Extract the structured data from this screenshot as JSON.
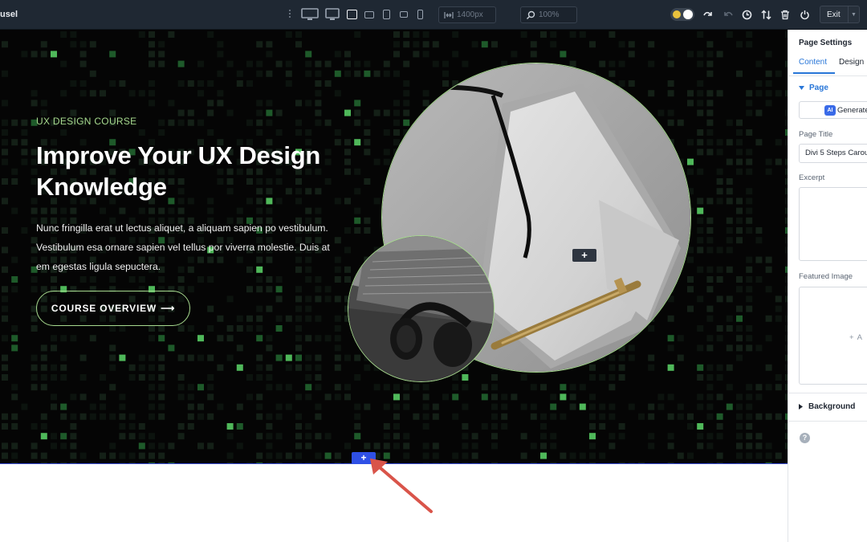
{
  "toolbar": {
    "title": "usel",
    "width_value": "1400px",
    "zoom_value": "100%",
    "exit_label": "Exit",
    "icons": [
      "desktop-wide-icon",
      "desktop-icon",
      "laptop-icon",
      "tablet-landscape-icon",
      "tablet-portrait-icon",
      "phone-landscape-icon",
      "phone-portrait-icon",
      "width-icon",
      "zoom-icon",
      "theme-toggle",
      "undo-icon",
      "redo-icon",
      "history-icon",
      "sort-icon",
      "trash-icon",
      "power-icon"
    ]
  },
  "hero": {
    "kicker": "UX DESIGN COURSE",
    "headline": "Improve Your UX Design Knowledge",
    "body": "Nunc fringilla erat ut lectus aliquet, a aliquam sapien po vestibulum. Vestibulum esa ornare sapien vel tellus por viverra molestie. Duis at em egestas ligula sepuctera.",
    "cta_label": "COURSE OVERVIEW",
    "cta_arrow": "⟶",
    "add_module": "+",
    "accent": "#a6d98e"
  },
  "section": {
    "add_label": "+"
  },
  "panel": {
    "title": "Page Settings",
    "tabs": [
      "Content",
      "Design"
    ],
    "group_page": "Page",
    "ai_badge": "AI",
    "generate_label": "Generate",
    "page_title_label": "Page Title",
    "page_title_value": "Divi 5 Steps Carou",
    "excerpt_label": "Excerpt",
    "featured_image_label": "Featured Image",
    "add_image": "A",
    "group_background": "Background",
    "help": "?"
  }
}
